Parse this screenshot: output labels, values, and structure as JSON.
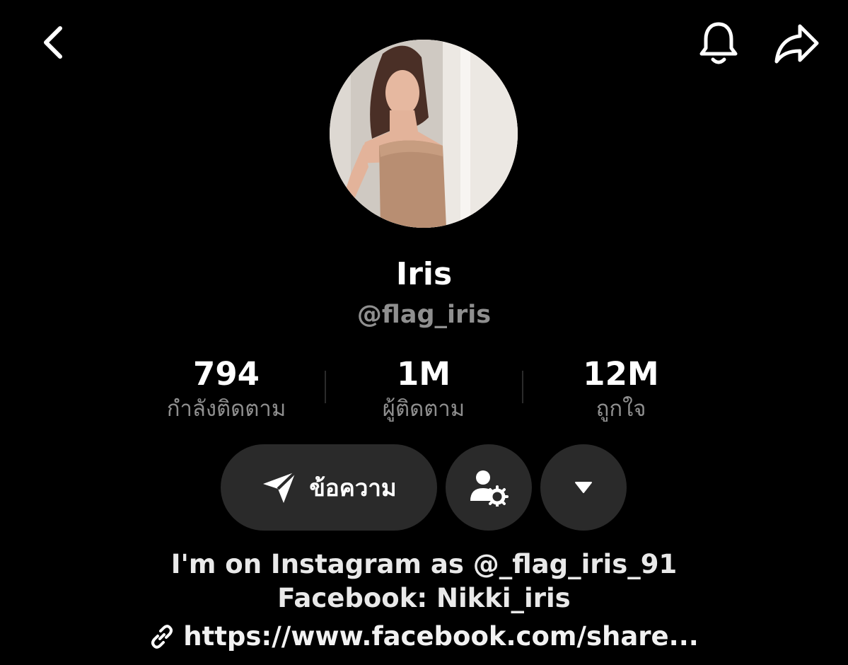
{
  "header": {
    "back_icon": "chevron-left-icon",
    "notification_icon": "bell-icon",
    "share_icon": "share-arrow-icon"
  },
  "profile": {
    "display_name": "Iris",
    "username": "@flag_iris"
  },
  "stats": [
    {
      "value": "794",
      "label": "กำลังติดตาม"
    },
    {
      "value": "1M",
      "label": "ผู้ติดตาม"
    },
    {
      "value": "12M",
      "label": "ถูกใจ"
    }
  ],
  "actions": {
    "message_label": "ข้อความ",
    "message_icon": "send-icon",
    "add_friend_icon": "user-settings-icon",
    "more_icon": "caret-down-icon"
  },
  "bio": {
    "line1": "I'm on Instagram as @_flag_iris_91",
    "line2": "Facebook: Nikki_iris",
    "link_icon": "link-icon",
    "link": "https://www.facebook.com/share..."
  },
  "colors": {
    "background": "#000000",
    "button_bg": "#2a2a2a",
    "secondary_text": "#8f8f8f"
  }
}
